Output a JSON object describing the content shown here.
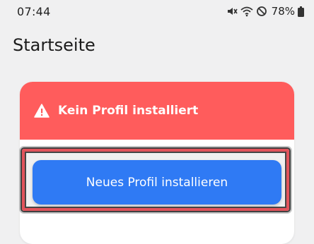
{
  "status_bar": {
    "time": "07:44",
    "battery": "78%",
    "icons": [
      "mute-icon",
      "wifi-icon",
      "do-not-disturb-icon",
      "battery-icon"
    ]
  },
  "page": {
    "title": "Startseite"
  },
  "alert_card": {
    "header_text": "Kein Profil installiert",
    "header_color": "#ff5c5c",
    "icon": "warning-icon"
  },
  "actions": {
    "install_button_label": "Neues Profil installieren",
    "button_color": "#2f7af4"
  }
}
